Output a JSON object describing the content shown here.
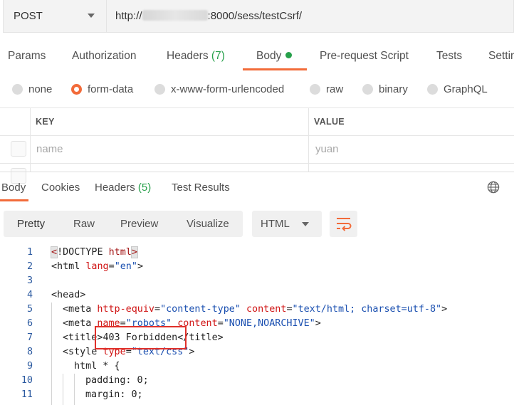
{
  "request": {
    "method": "POST",
    "url_prefix": "http://",
    "url_suffix": ":8000/sess/testCsrf/"
  },
  "request_tabs": [
    {
      "label": "Params"
    },
    {
      "label": "Authorization"
    },
    {
      "label": "Headers",
      "count": "(7)"
    },
    {
      "label": "Body"
    },
    {
      "label": "Pre-request Script"
    },
    {
      "label": "Tests"
    },
    {
      "label": "Settin"
    }
  ],
  "body_types": [
    {
      "label": "none",
      "checked": false
    },
    {
      "label": "form-data",
      "checked": true
    },
    {
      "label": "x-www-form-urlencoded",
      "checked": false
    },
    {
      "label": "raw",
      "checked": false
    },
    {
      "label": "binary",
      "checked": false
    },
    {
      "label": "GraphQL",
      "checked": false
    }
  ],
  "form_table": {
    "headers": [
      "KEY",
      "VALUE"
    ],
    "rows": [
      {
        "key": "name",
        "value": "yuan"
      }
    ]
  },
  "response_tabs": [
    {
      "label": "Body"
    },
    {
      "label": "Cookies"
    },
    {
      "label": "Headers",
      "count": "(5)"
    },
    {
      "label": "Test Results"
    }
  ],
  "view_modes": [
    "Pretty",
    "Raw",
    "Preview",
    "Visualize"
  ],
  "language": "HTML",
  "code": {
    "line_numbers": [
      "1",
      "2",
      "3",
      "4",
      "5",
      "6",
      "7",
      "8",
      "9",
      "10",
      "11"
    ],
    "l1": {
      "open": "<",
      "text": "!DOCTYPE ",
      "tag": "html",
      "close": ">"
    },
    "l2": {
      "tag_open": "<html ",
      "attr": "lang",
      "eq": "=",
      "val": "\"en\"",
      "end": ">"
    },
    "l4": {
      "tag": "<head>"
    },
    "l5": {
      "tag_open": "<meta ",
      "attr1": "http-equiv",
      "eq1": "=",
      "val1": "\"content-type\"",
      "sp": " ",
      "attr2": "content",
      "eq2": "=",
      "val2": "\"text/html; charset=utf-8\"",
      "end": ">"
    },
    "l6": {
      "tag_open": "<meta ",
      "attr1": "name",
      "eq1": "=",
      "val1": "\"robots\"",
      "sp": " ",
      "attr2": "content",
      "eq2": "=",
      "val2": "\"NONE,NOARCHIVE\"",
      "end": ">"
    },
    "l7": {
      "tag_open": "<title>",
      "text": "403 Forbidden",
      "tag_close": "</title>"
    },
    "l8": {
      "tag_open": "<style ",
      "attr": "type",
      "eq": "=",
      "val": "\"text/css\"",
      "end": ">"
    },
    "l9": {
      "text": "html * {"
    },
    "l10": {
      "text": "padding: 0;"
    },
    "l11": {
      "text": "margin: 0;"
    }
  },
  "colors": {
    "accent": "#f26b3a",
    "count_green": "#26a04a",
    "annotation_red": "#e0302a"
  }
}
